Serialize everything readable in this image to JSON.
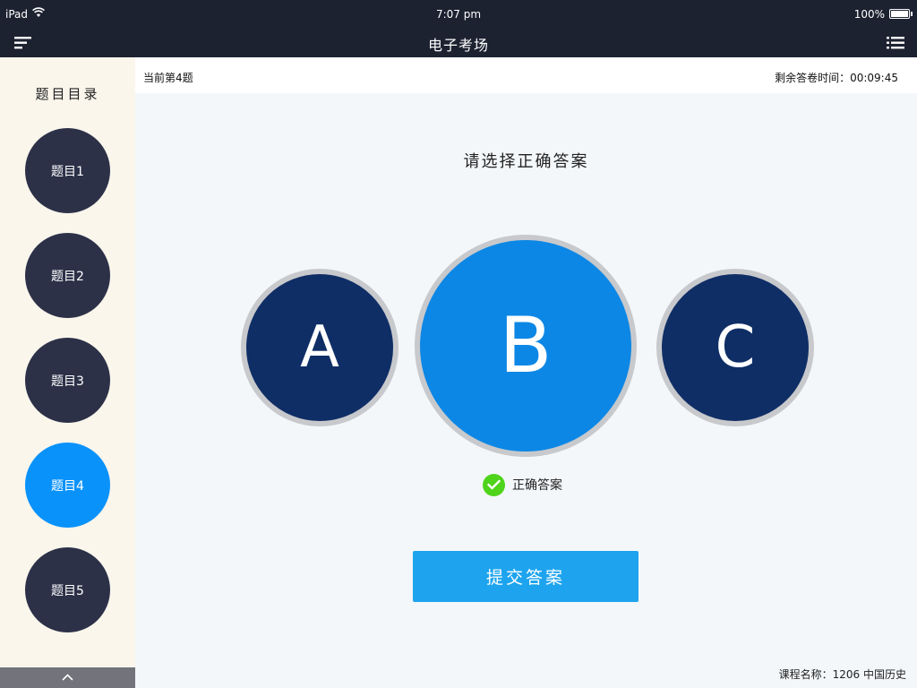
{
  "status_bar": {
    "carrier": "iPad",
    "time": "7:07 pm",
    "battery": "100%"
  },
  "nav": {
    "title": "电子考场"
  },
  "sidebar": {
    "title": "题目目录",
    "items": [
      {
        "label": "题目1"
      },
      {
        "label": "题目2"
      },
      {
        "label": "题目3"
      },
      {
        "label": "题目4"
      },
      {
        "label": "题目5"
      }
    ]
  },
  "info_bar": {
    "current_question": "当前第4题",
    "remaining_time": "剩余答卷时间：00:09:45"
  },
  "question": {
    "prompt": "请选择正确答案",
    "options": [
      "A",
      "B",
      "C"
    ],
    "correct_hint": "正确答案"
  },
  "submit_label": "提交答案",
  "course_name": "课程名称：1206 中国历史",
  "colors": {
    "header_bg": "#1d2231",
    "sidebar_bg": "#faf6ec",
    "question_item": "#2c3148",
    "active_item": "#0a92fb",
    "option_dark": "#0f2e66",
    "option_selected": "#0c87e5",
    "correct_green": "#4fd31b",
    "submit_button": "#1ea4ee"
  }
}
